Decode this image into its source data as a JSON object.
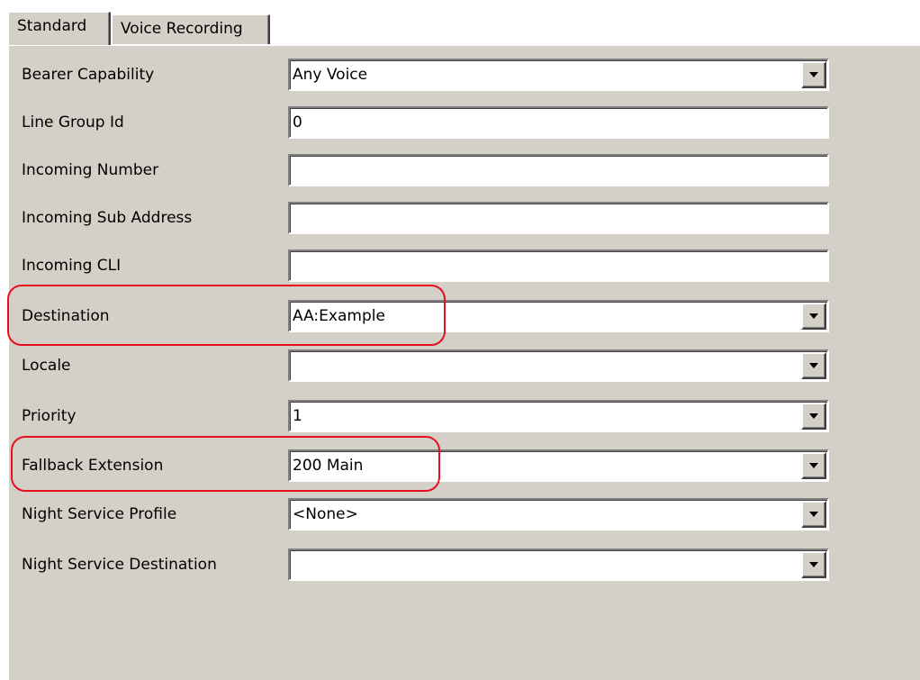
{
  "tabs": [
    {
      "label": "Standard",
      "active": true
    },
    {
      "label": "Voice Recording",
      "active": false
    }
  ],
  "fields": [
    {
      "label": "Bearer Capability",
      "value": "Any Voice",
      "type": "dropdown"
    },
    {
      "label": "Line Group Id",
      "value": "0",
      "type": "text"
    },
    {
      "label": "Incoming Number",
      "value": "",
      "type": "text"
    },
    {
      "label": "Incoming Sub Address",
      "value": "",
      "type": "text"
    },
    {
      "label": "Incoming CLI",
      "value": "",
      "type": "text"
    },
    {
      "label": "Destination",
      "value": "AA:Example",
      "type": "dropdown",
      "highlighted": true
    },
    {
      "label": "Locale",
      "value": "",
      "type": "dropdown"
    },
    {
      "label": "Priority",
      "value": "1",
      "type": "dropdown"
    },
    {
      "label": "Fallback Extension",
      "value": "200 Main",
      "type": "dropdown",
      "highlighted": true
    },
    {
      "label": "Night Service Profile",
      "value": "<None>",
      "type": "dropdown"
    },
    {
      "label": "Night Service Destination",
      "value": "",
      "type": "dropdown"
    }
  ],
  "colors": {
    "panel_bg": "#d4d0c8",
    "highlight": "#e8101e"
  },
  "icons": {
    "dropdown": "chevron-down-icon"
  }
}
